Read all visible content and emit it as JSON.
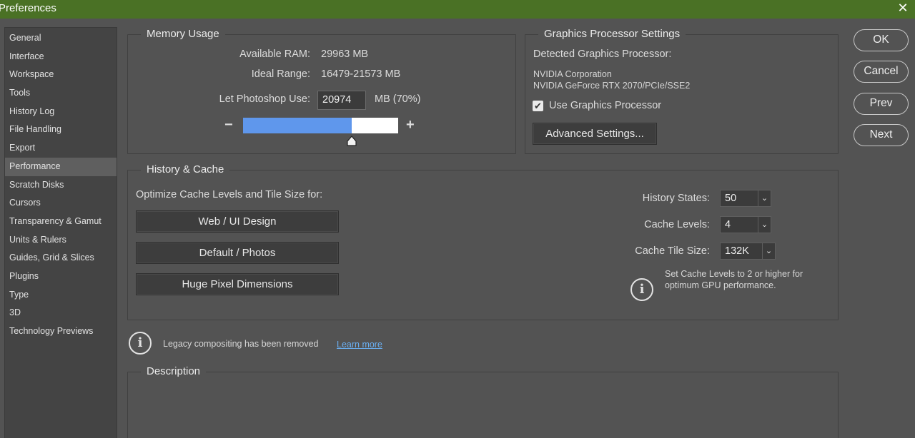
{
  "window": {
    "title": "Preferences",
    "close_glyph": "✕"
  },
  "sidebar": {
    "items": [
      "General",
      "Interface",
      "Workspace",
      "Tools",
      "History Log",
      "File Handling",
      "Export",
      "Performance",
      "Scratch Disks",
      "Cursors",
      "Transparency & Gamut",
      "Units & Rulers",
      "Guides, Grid & Slices",
      "Plugins",
      "Type",
      "3D",
      "Technology Previews"
    ],
    "active": "Performance"
  },
  "memory": {
    "legend": "Memory Usage",
    "available_label": "Available RAM:",
    "available_value": "29963 MB",
    "ideal_label": "Ideal Range:",
    "ideal_value": "16479-21573 MB",
    "use_label": "Let Photoshop Use:",
    "use_value": "20974",
    "use_suffix": "MB (70%)",
    "slider_fraction": 0.7,
    "minus": "−",
    "plus": "+"
  },
  "gpu": {
    "legend": "Graphics Processor Settings",
    "detected_label": "Detected Graphics Processor:",
    "vendor": "NVIDIA Corporation",
    "model": "NVIDIA GeForce RTX 2070/PCIe/SSE2",
    "use_label": "Use Graphics Processor",
    "use_checked": true,
    "advanced_button": "Advanced Settings..."
  },
  "history_cache": {
    "legend": "History & Cache",
    "optimize_label": "Optimize Cache Levels and Tile Size for:",
    "preset_buttons": [
      "Web / UI Design",
      "Default / Photos",
      "Huge Pixel Dimensions"
    ],
    "history_states_label": "History States:",
    "history_states_value": "50",
    "cache_levels_label": "Cache Levels:",
    "cache_levels_value": "4",
    "tile_size_label": "Cache Tile Size:",
    "tile_size_value": "132K",
    "hint_line1": "Set Cache Levels to 2 or higher for",
    "hint_line2": "optimum GPU performance."
  },
  "legacy": {
    "message": "Legacy compositing has been removed",
    "link": "Learn more"
  },
  "description": {
    "legend": "Description"
  },
  "actions": {
    "ok": "OK",
    "cancel": "Cancel",
    "prev": "Prev",
    "next": "Next"
  },
  "icons": {
    "info": "i",
    "chevron": "⌄",
    "check": "✔"
  },
  "colors": {
    "titlebar": "#4a7125",
    "slider_fill": "#5f97ec",
    "link": "#6aaef0"
  }
}
